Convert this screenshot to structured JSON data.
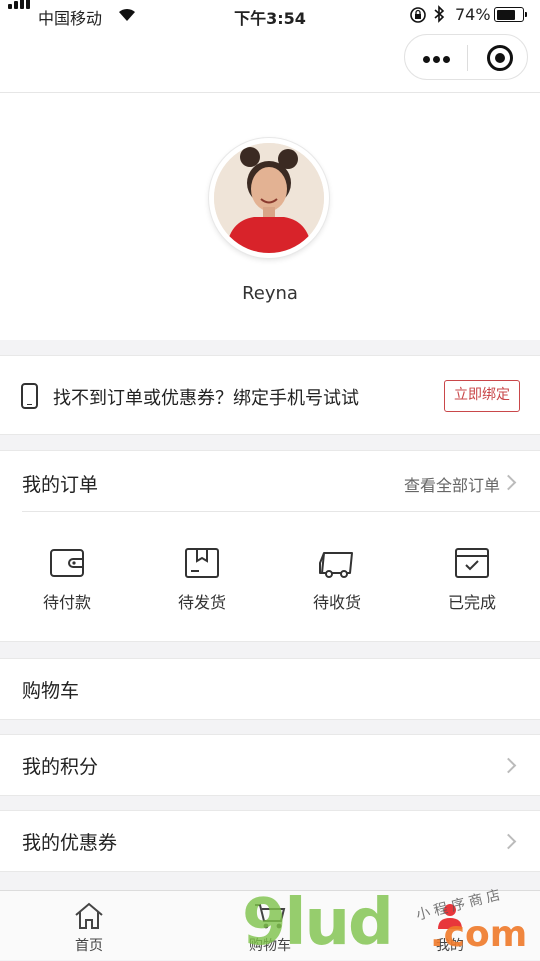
{
  "status_bar": {
    "carrier": "中国移动",
    "time": "下午3:54",
    "battery_percent": "74%",
    "battery_level": 0.74
  },
  "profile": {
    "username": "Reyna"
  },
  "bind_phone": {
    "text": "找不到订单或优惠券？绑定手机号试试",
    "button_label": "立即绑定"
  },
  "orders": {
    "title": "我的订单",
    "view_all": "查看全部订单",
    "statuses": [
      {
        "label": "待付款",
        "icon": "wallet-icon"
      },
      {
        "label": "待发货",
        "icon": "package-icon"
      },
      {
        "label": "待收货",
        "icon": "delivery-truck-icon"
      },
      {
        "label": "已完成",
        "icon": "completed-box-icon"
      }
    ]
  },
  "menu": {
    "cart": "购物车",
    "points": "我的积分",
    "coupons": "我的优惠券"
  },
  "tabbar": {
    "items": [
      {
        "label": "首页",
        "icon": "home-icon"
      },
      {
        "label": "购物车",
        "icon": "cart-icon"
      },
      {
        "label": "我的",
        "icon": "user-icon"
      }
    ]
  },
  "watermark": {
    "brand": "9lud",
    "domain": ".com",
    "tagline": "小程序商店"
  },
  "colors": {
    "accent": "#c9474a",
    "background": "#f3f3f5"
  }
}
